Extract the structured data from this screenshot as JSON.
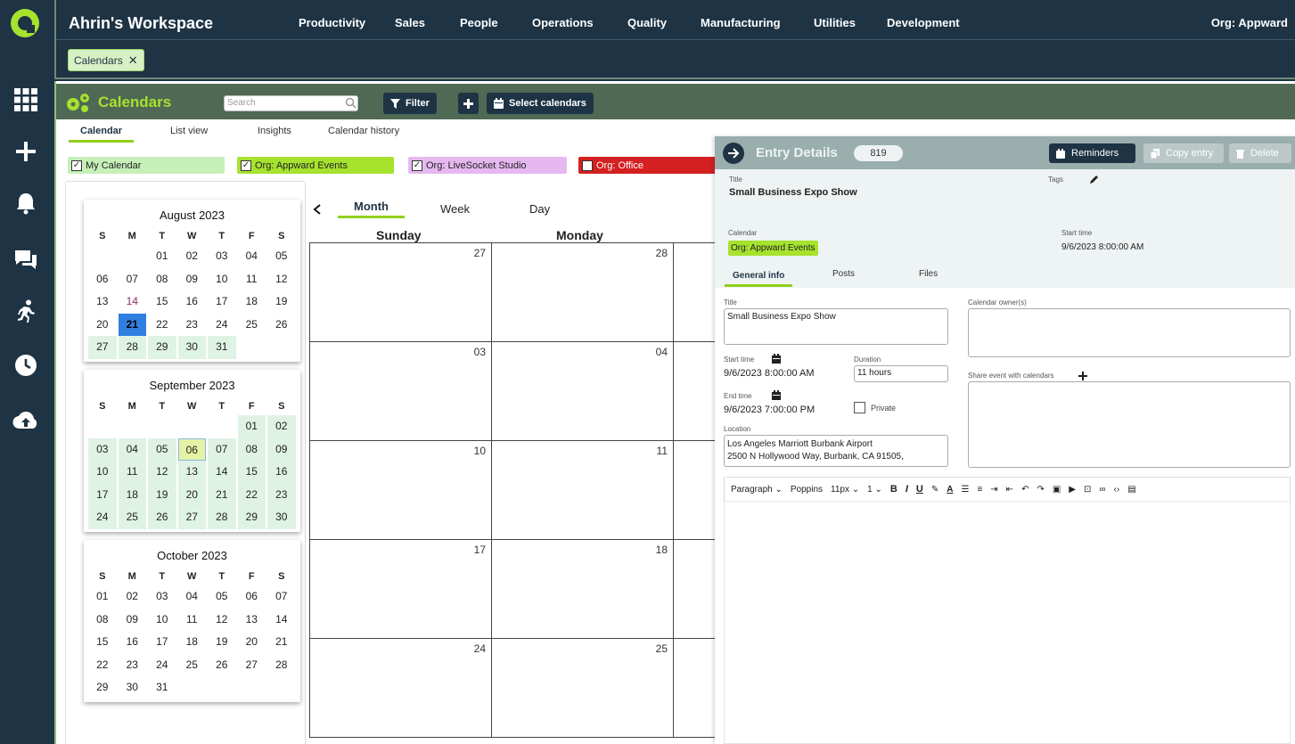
{
  "workspace_title": "Ahrin's Workspace",
  "nav": [
    "Productivity",
    "Sales",
    "People",
    "Operations",
    "Quality",
    "Manufacturing",
    "Utilities",
    "Development"
  ],
  "org": "Org:  Appward",
  "open_tab": "Calendars",
  "rail_icons": [
    "apps-grid-icon",
    "plus-icon",
    "bell-icon",
    "chat-icon",
    "runner-icon",
    "clock-icon",
    "cloud-upload-icon"
  ],
  "toolbar": {
    "title": "Calendars",
    "search_placeholder": "Search",
    "filter_label": "Filter",
    "select_calendars_label": "Select calendars"
  },
  "view_tabs": [
    "Calendar",
    "List view",
    "Insights",
    "Calendar history"
  ],
  "calendars": [
    {
      "label": "My Calendar",
      "color": "#c6f0b8"
    },
    {
      "label": "Org: Appward Events",
      "color": "#a6e22e"
    },
    {
      "label": "Org: LiveSocket Studio",
      "color": "#e6b8f0"
    },
    {
      "label": "Org: Office",
      "color": "#d42020"
    }
  ],
  "weekday_letters": [
    "S",
    "M",
    "T",
    "W",
    "T",
    "F",
    "S"
  ],
  "mini_months": [
    {
      "name": "August 2023",
      "offset": 2,
      "days": 31,
      "event_from": 27,
      "today": 21,
      "selected": null,
      "highlight_text": 14
    },
    {
      "name": "September 2023",
      "offset": 5,
      "days": 30,
      "event_from": 1,
      "today": null,
      "selected": 6,
      "highlight_text": null
    },
    {
      "name": "October 2023",
      "offset": 0,
      "days": 31,
      "event_from": 99,
      "today": null,
      "selected": null,
      "highlight_text": null
    }
  ],
  "calendar_view": {
    "prev_label": "‹",
    "modes": [
      "Month",
      "Week",
      "Day"
    ],
    "day_headers": [
      "Sunday",
      "Monday"
    ],
    "weeks": [
      [
        "27",
        "28"
      ],
      [
        "03",
        "04"
      ],
      [
        "10",
        "11"
      ],
      [
        "17",
        "18"
      ],
      [
        "24",
        "25"
      ]
    ]
  },
  "entry": {
    "header": "Entry Details",
    "id": "819",
    "reminders_label": "Reminders",
    "copy_label": "Copy entry",
    "delete_label": "Delete",
    "title_label": "Title",
    "title": "Small Business Expo Show",
    "tags_label": "Tags",
    "calendar_label": "Calendar",
    "calendar": "Org: Appward Events",
    "start_label": "Start time",
    "start": "9/6/2023 8:00:00 AM",
    "tabs": [
      "General info",
      "Posts",
      "Files"
    ],
    "form": {
      "title_label": "Title",
      "title_value": "Small Business Expo Show",
      "owners_label": "Calendar owner(s)",
      "start_label": "Start time",
      "start_value": "9/6/2023 8:00:00 AM",
      "duration_label": "Duration",
      "duration_value": "11 hours",
      "share_label": "Share event with calendars",
      "end_label": "End time",
      "end_value": "9/6/2023 7:00:00 PM",
      "private_label": "Private",
      "location_label": "Location",
      "location_line1": "Los Angeles Marriott Burbank Airport",
      "location_line2": "2500 N Hollywood Way, Burbank, CA  91505,"
    },
    "editor": {
      "block": "Paragraph",
      "font": "Poppins",
      "size": "11px",
      "line_height": "1"
    }
  }
}
